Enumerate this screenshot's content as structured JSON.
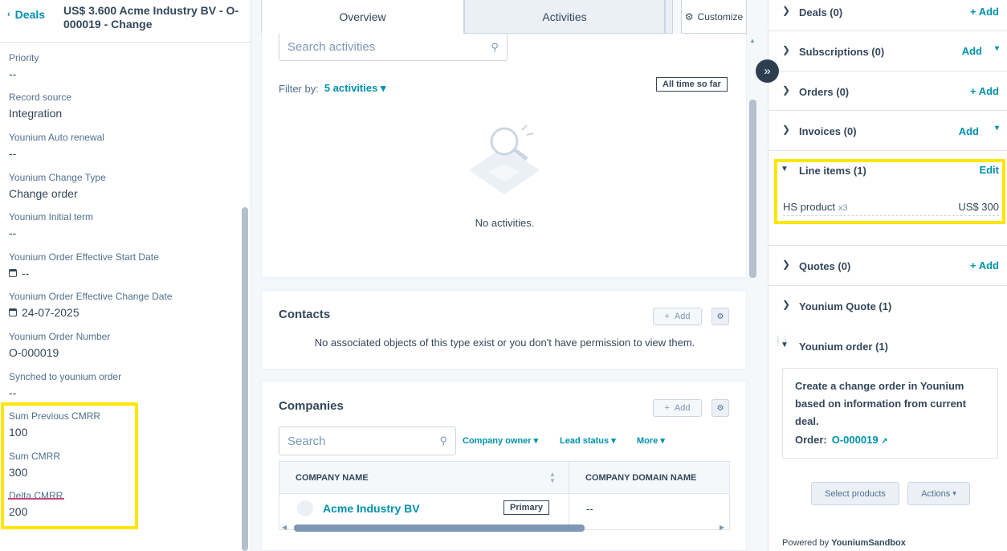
{
  "left": {
    "back_label": "Deals",
    "deal_title": "US$ 3.600 Acme Industry BV - O-000019 - Change",
    "props": [
      {
        "label": "Priority",
        "value": "--"
      },
      {
        "label": "Record source",
        "value": "Integration"
      },
      {
        "label": "Younium Auto renewal",
        "value": "--"
      },
      {
        "label": "Younium Change Type",
        "value": "Change order"
      },
      {
        "label": "Younium Initial term",
        "value": "--"
      },
      {
        "label": "Younium Order Effective Start Date",
        "value": "--"
      },
      {
        "label": "Younium Order Effective Change Date",
        "value": "24-07-2025"
      },
      {
        "label": "Younium Order Number",
        "value": "O-000019"
      },
      {
        "label": "Synched to younium order",
        "value": "--"
      },
      {
        "label": "Sum Previous CMRR",
        "value": "100"
      },
      {
        "label": "Sum CMRR",
        "value": "300"
      },
      {
        "label": "Delta CMRR",
        "value": "200"
      }
    ]
  },
  "middle": {
    "tabs": {
      "overview": "Overview",
      "activities": "Activities",
      "customize": "Customize"
    },
    "activities": {
      "search_placeholder": "Search activities",
      "filter_label": "Filter by:",
      "filter_value": "5 activities",
      "time_range": "All time so far",
      "empty_text": "No activities."
    },
    "contacts": {
      "title": "Contacts",
      "add_label": "Add",
      "empty_text": "No associated objects of this type exist or you don't have permission to view them."
    },
    "companies": {
      "title": "Companies",
      "add_label": "Add",
      "search_placeholder": "Search",
      "filters": [
        "Company owner",
        "Lead status",
        "More"
      ],
      "columns": [
        "COMPANY NAME",
        "COMPANY DOMAIN NAME"
      ],
      "rows": [
        {
          "name": "Acme Industry BV",
          "badge": "Primary",
          "domain": "--"
        }
      ]
    }
  },
  "right": {
    "deals": {
      "title": "Deals (0)",
      "action": "+ Add"
    },
    "subscriptions": {
      "title": "Subscriptions (0)",
      "action": "Add"
    },
    "orders": {
      "title": "Orders (0)",
      "action": "+ Add"
    },
    "invoices": {
      "title": "Invoices (0)",
      "action": "Add"
    },
    "line_items": {
      "title": "Line items (1)",
      "action": "Edit",
      "item_name": "HS product",
      "item_qty": "x3",
      "item_price": "US$ 300"
    },
    "quotes": {
      "title": "Quotes (0)",
      "action": "+ Add"
    },
    "younium_quote": {
      "title": "Younium Quote (1)"
    },
    "younium_order": {
      "title": "Younium order (1)",
      "description": "Create a change order in Younium based on information from current deal.",
      "order_label": "Order:",
      "order_number": "O-000019"
    },
    "select_products": "Select products",
    "actions": "Actions",
    "powered_prefix": "Powered by",
    "powered_name": "YouniumSandbox"
  },
  "colors": {
    "accent": "#0091ae",
    "highlight": "#ffe600",
    "text": "#33475b"
  }
}
